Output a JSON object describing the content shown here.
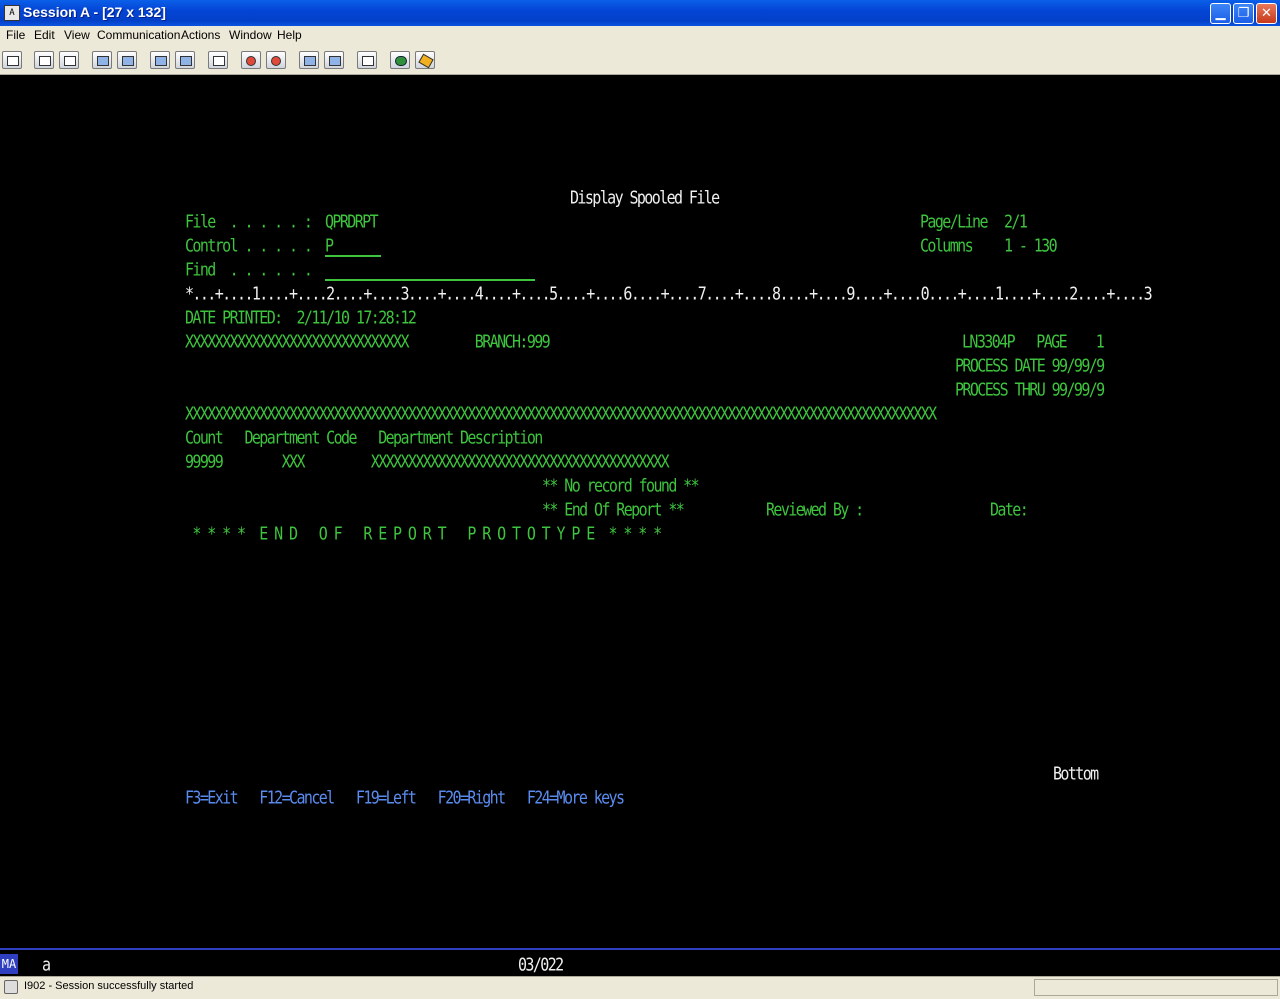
{
  "window": {
    "title": "Session A - [27 x 132]",
    "icon_text": "A",
    "minimize_glyph": "▁",
    "restore_glyph": "❐",
    "close_glyph": "✕"
  },
  "menu": [
    "File",
    "Edit",
    "View",
    "Communication",
    "Actions",
    "Window",
    "Help"
  ],
  "toolbar_icons": [
    "print-screen-icon",
    "copy-icon",
    "paste-icon",
    "send-file-icon",
    "receive-file-icon",
    "display-icon",
    "keypad-icon",
    "stats-icon",
    "record-macro-icon",
    "stop-macro-icon",
    "play-macro-icon",
    "macro-list-icon",
    "clipboard-icon",
    "globe-icon",
    "key-icon"
  ],
  "screen": {
    "heading": "Display Spooled File",
    "file_label": "File  . . . . . :",
    "file_value": "QPRDRPT",
    "control_label": "Control . . . . .",
    "control_value": "P",
    "find_label": "Find  . . . . . .",
    "page_line_label": "Page/Line",
    "page_line_value": "2/1",
    "columns_label": "Columns",
    "columns_value": "1 - 130",
    "ruler": "*...+....1....+....2....+....3....+....4....+....5....+....6....+....7....+....8....+....9....+....0....+....1....+....2....+....3",
    "report_lines": [
      "DATE PRINTED:  2/11/10 17:28:12",
      "XXXXXXXXXXXXXXXXXXXXXXXXXXXXXX         BRANCH:999",
      "LN3304P   PAGE    1",
      "PROCESS DATE 99/99/9",
      "PROCESS THRU 99/99/9",
      "XXXXXXXXXXXXXXXXXXXXXXXXXXXXXXXXXXXXXXXXXXXXXXXXXXXXXXXXXXXXXXXXXXXXXXXXXXXXXXXXXXXXXXXXXXXXXXXXXXXXX",
      "Count   Department Code   Department Description",
      "99999        XXX         XXXXXXXXXXXXXXXXXXXXXXXXXXXXXXXXXXXXXXXX",
      "** No record found **",
      "** End Of Report **",
      "Reviewed By :",
      "Date:",
      " * * * *  E N D   O F   R E P O R T   P R O T O T Y P E  * * * *"
    ],
    "bottom": "Bottom",
    "function_keys": "F3=Exit   F12=Cancel   F19=Left   F20=Right   F24=More keys"
  },
  "oia": {
    "indicator": "MA",
    "input": "a",
    "cursor_pos": "03/022"
  },
  "status": {
    "message": "I902 - Session successfully started"
  },
  "colors": {
    "terminal_green": "#3ec43e",
    "terminal_white": "#f0f0f0",
    "terminal_blue": "#5a8cf0",
    "title_blue": "#0445d6"
  }
}
